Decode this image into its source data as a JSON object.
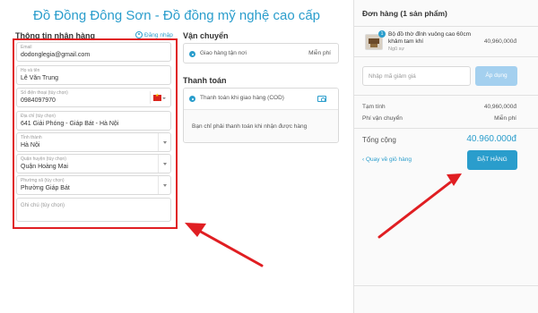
{
  "store": {
    "title": "Đồ Đồng Đông Sơn - Đồ đồng mỹ nghệ cao cấp"
  },
  "recipient": {
    "heading": "Thông tin nhận hàng",
    "login_link": "Đăng nhập",
    "fields": {
      "email": {
        "label": "Email",
        "value": "dodonglegia@gmail.com"
      },
      "name": {
        "label": "Họ và tên",
        "value": "Lê Văn Trung"
      },
      "phone": {
        "label": "Số điện thoại (tùy chọn)",
        "value": "0984097970"
      },
      "address": {
        "label": "Địa chỉ (tùy chọn)",
        "value": "641 Giải Phóng - Giáp Bát - Hà Nội"
      },
      "province": {
        "label": "Tỉnh thành",
        "value": "Hà Nội"
      },
      "district": {
        "label": "Quận huyện (tùy chọn)",
        "value": "Quận Hoàng Mai"
      },
      "ward": {
        "label": "Phường xã (tùy chọn)",
        "value": "Phường Giáp Bát"
      },
      "note": {
        "placeholder": "Ghi chú (tùy chọn)"
      }
    }
  },
  "shipping": {
    "heading": "Vận chuyển",
    "option": "Giao hàng tận nơi",
    "price": "Miễn phí"
  },
  "payment": {
    "heading": "Thanh toán",
    "option": "Thanh toán khi giao hàng (COD)",
    "description": "Bạn chỉ phải thanh toán khi nhận được hàng"
  },
  "order": {
    "heading": "Đơn hàng (1 sản phẩm)",
    "item": {
      "name_line1": "Bộ đồ thờ đỉnh vuông cao 60cm",
      "name_line2": "khảm tam khí",
      "variant": "Ngũ sự",
      "price": "40,960,000đ",
      "quantity": "1"
    },
    "coupon_placeholder": "Nhập mã giảm giá",
    "apply_label": "Áp dụng",
    "subtotal_label": "Tạm tính",
    "subtotal_value": "40,960,000đ",
    "shipping_fee_label": "Phí vận chuyển",
    "shipping_fee_value": "Miễn phí",
    "total_label": "Tổng cộng",
    "total_value": "40.960.000đ",
    "back_link": "Quay về giỏ hàng",
    "place_order": "ĐẶT HÀNG"
  },
  "colors": {
    "accent": "#2a9dcc",
    "highlight": "#e01e22"
  }
}
